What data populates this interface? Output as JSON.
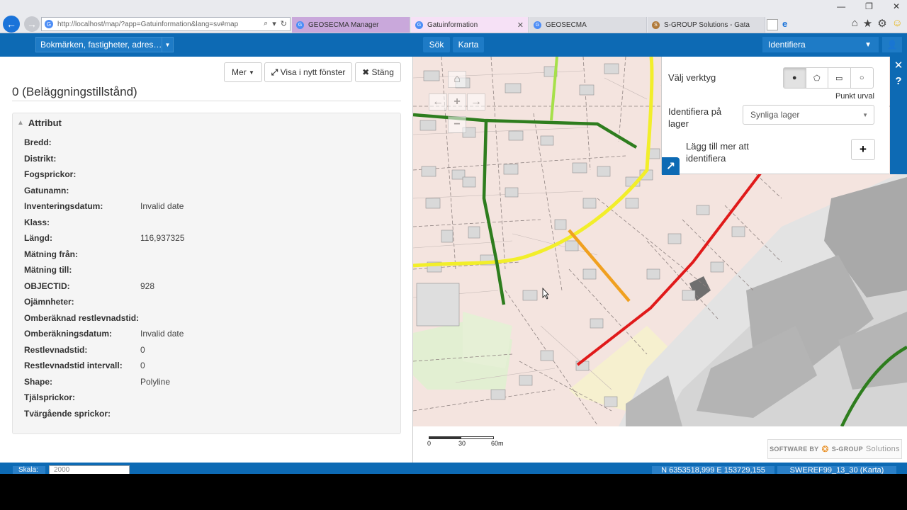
{
  "browser": {
    "address": "http://localhost/map/?app=Gatuinformation&lang=sv#map",
    "tabs": [
      {
        "label": "GEOSECMA Manager"
      },
      {
        "label": "Gatuinformation"
      },
      {
        "label": "GEOSECMA"
      },
      {
        "label": "S-GROUP Solutions - Gata"
      }
    ]
  },
  "toolbar": {
    "bookmarks": "Bokmärken, fastigheter, adres…",
    "search": "Sök",
    "map": "Karta",
    "identify": "Identifiera"
  },
  "panel": {
    "buttons": {
      "more": "Mer",
      "open_new_window": "Visa i nytt fönster",
      "close": "Stäng"
    },
    "title": "0 (Beläggningstillstånd)",
    "section": "Attribut",
    "attributes": [
      {
        "key": "Bredd:",
        "value": ""
      },
      {
        "key": "Distrikt:",
        "value": ""
      },
      {
        "key": "Fogsprickor:",
        "value": ""
      },
      {
        "key": "Gatunamn:",
        "value": ""
      },
      {
        "key": "Inventeringsdatum:",
        "value": "Invalid date"
      },
      {
        "key": "Klass:",
        "value": ""
      },
      {
        "key": "Längd:",
        "value": "116,937325"
      },
      {
        "key": "Mätning från:",
        "value": ""
      },
      {
        "key": "Mätning till:",
        "value": ""
      },
      {
        "key": "OBJECTID:",
        "value": "928"
      },
      {
        "key": "Ojämnheter:",
        "value": ""
      },
      {
        "key": "Omberäknad restlevnadstid:",
        "value": ""
      },
      {
        "key": "Omberäkningsdatum:",
        "value": "Invalid date"
      },
      {
        "key": "Restlevnadstid:",
        "value": "0"
      },
      {
        "key": "Restlevnadstid intervall:",
        "value": "0"
      },
      {
        "key": "Shape:",
        "value": "Polyline"
      },
      {
        "key": "Tjälsprickor:",
        "value": ""
      },
      {
        "key": "Tvärgående sprickor:",
        "value": ""
      }
    ]
  },
  "identify_panel": {
    "tool_label": "Välj verktyg",
    "selected_tool": "Punkt urval",
    "layer_label": "Identifiera på lager",
    "layer_value": "Synliga lager",
    "add_label": "Lägg till mer att identifiera"
  },
  "scale": {
    "labels": [
      "0",
      "30",
      "60m"
    ]
  },
  "logo": {
    "prefix": "SOFTWARE BY",
    "brand": "S-GROUP",
    "suffix": "Solutions"
  },
  "status": {
    "scale_label": "Skala:",
    "scale_value": "2000",
    "coords": "N 6353518,999 E 153729,155",
    "projection": "SWEREF99_13_30 (Karta)"
  },
  "colors": {
    "accent": "#0d6ab4",
    "road_good": "#2e7d1e",
    "road_ok": "#f2ee2a",
    "road_warn": "#f0a020",
    "road_bad": "#e01a1a",
    "light_green": "#a6e04a"
  }
}
